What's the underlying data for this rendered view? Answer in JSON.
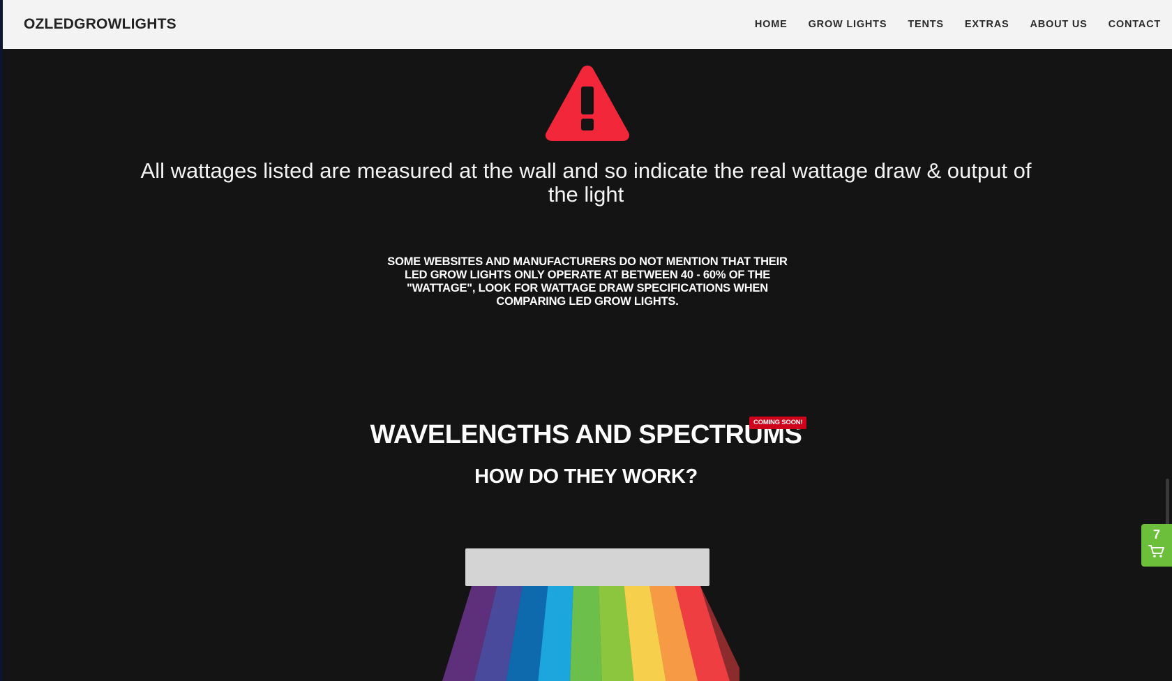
{
  "header": {
    "brand": "OZLEDGROWLIGHTS",
    "nav": [
      "HOME",
      "GROW LIGHTS",
      "TENTS",
      "EXTRAS",
      "ABOUT US",
      "CONTACT"
    ]
  },
  "warning": {
    "icon": "warning-triangle-icon",
    "color": "#f2283a",
    "main_text": "All wattages listed are measured at the wall and so indicate the real wattage draw & output of the light",
    "sub_text": "SOME WEBSITES AND MANUFACTURERS DO NOT MENTION THAT THEIR LED GROW LIGHTS ONLY OPERATE AT BETWEEN 40 - 60% OF THE \"WATTAGE\", LOOK FOR WATTAGE DRAW SPECIFICATIONS WHEN COMPARING LED GROW LIGHTS."
  },
  "spectrum_section": {
    "title": "WAVELENGTHS AND SPECTRUMS",
    "badge": "COMING SOON!",
    "subtitle": "HOW DO THEY WORK?",
    "colors": [
      "#5e2f7a",
      "#4a4a9c",
      "#0e6aad",
      "#1ca6dd",
      "#6cbf4a",
      "#8cc63f",
      "#f6d04d",
      "#f79a45",
      "#ef3e42"
    ]
  },
  "cart": {
    "count": "7",
    "icon": "shopping-cart-icon",
    "color": "#6cbf3b"
  }
}
